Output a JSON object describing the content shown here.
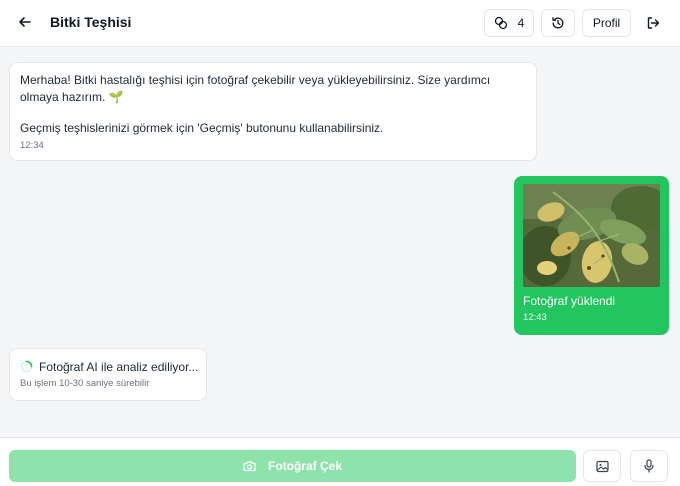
{
  "header": {
    "title": "Bitki Teşhisi",
    "count": "4",
    "profile_label": "Profil"
  },
  "messages": {
    "welcome": {
      "line1": "Merhaba! Bitki hastalığı teşhisi için fotoğraf çekebilir veya yükleyebilirsiniz. Size yardımcı",
      "line2": "olmaya hazırım. 🌱",
      "line3": "Geçmiş teşhislerinizi görmek için 'Geçmiş' butonunu kullanabilirsiniz.",
      "time": "12:34"
    },
    "upload": {
      "caption": "Fotoğraf yüklendi",
      "time": "12:43"
    },
    "analyzing": {
      "text": "Fotoğraf AI ile analiz ediliyor...",
      "subtext": "Bu işlem 10-30 saniye sürebilir"
    }
  },
  "footer": {
    "capture_label": "Fotoğraf Çek"
  },
  "colors": {
    "accent": "#22c55e",
    "accent_disabled": "#8ee3ac"
  },
  "icons": [
    "back-arrow-icon",
    "leaf-count-icon",
    "history-icon",
    "logout-icon",
    "camera-icon",
    "image-icon",
    "microphone-icon",
    "spinner-icon",
    "plant-emoji-icon"
  ]
}
